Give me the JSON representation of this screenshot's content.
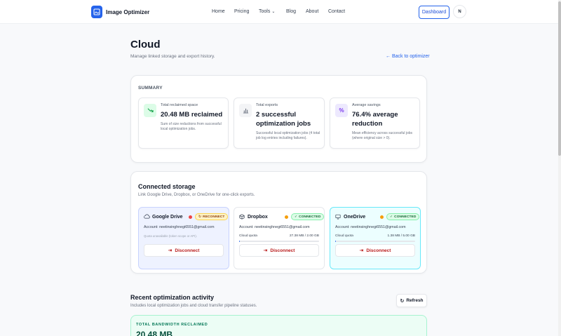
{
  "brand": {
    "name": "Image Optimizer",
    "accent": "#2563eb"
  },
  "nav": {
    "items": [
      "Home",
      "Pricing",
      "Tools",
      "Blog",
      "About",
      "Contact"
    ],
    "dashboard_label": "Dashboard",
    "avatar_initial": "N"
  },
  "page": {
    "title": "Cloud",
    "subtitle": "Manage linked storage and export history.",
    "back_link": "← Back to optimizer"
  },
  "summary": {
    "label": "SUMMARY",
    "stats": [
      {
        "label": "Total reclaimed space",
        "value": "20.48 MB reclaimed",
        "desc": "Sum of size reductions from successful local optimization jobs.",
        "icon": "trend-down-icon",
        "color": "#16a34a"
      },
      {
        "label": "Total exports",
        "value": "2 successful optimization jobs",
        "desc": "Successful local optimization jobs (4 total job log entries including failures).",
        "icon": "bar-chart-icon",
        "color": "#6b7280"
      },
      {
        "label": "Average savings",
        "value": "76.4% average reduction",
        "desc": "Mean efficiency across successful jobs (where original size > 0).",
        "icon": "percent-icon",
        "color": "#7c3aed"
      }
    ]
  },
  "storage": {
    "title": "Connected storage",
    "subtitle": "Link Google Drive, Dropbox, or OneDrive for one-click exports.",
    "providers": [
      {
        "name": "Google Drive",
        "icon": "cloud-icon",
        "dot_color": "#ef4444",
        "badge": "RECONNECT",
        "badge_icon": "↻",
        "account": "Account: neetinsinghnegi6551@gmail.com",
        "note": "Quota unavailable (token scope or API).",
        "disconnect": "Disconnect"
      },
      {
        "name": "Dropbox",
        "icon": "box-icon",
        "dot_color": "#f59e0b",
        "badge": "CONNECTED",
        "badge_icon": "✓",
        "account": "Account: neetinsinghnegi6551@gmail.com",
        "quota_label": "Cloud quota",
        "quota_value": "27.38 MB / 2.00 GB",
        "quota_fraction": 0.013,
        "disconnect": "Disconnect"
      },
      {
        "name": "OneDrive",
        "icon": "monitor-icon",
        "dot_color": "#f59e0b",
        "badge": "CONNECTED",
        "badge_icon": "✓",
        "account": "Account: neetinsinghnegi6551@gmail.com",
        "quota_label": "Cloud quota",
        "quota_value": "1.38 MB / 5.00 GB",
        "quota_fraction": 0.0003,
        "disconnect": "Disconnect"
      }
    ]
  },
  "activity": {
    "title": "Recent optimization activity",
    "subtitle": "Includes local optimization jobs and cloud transfer pipeline statuses.",
    "refresh_label": "Refresh",
    "bandwidth_label": "TOTAL BANDWIDTH RECLAIMED",
    "bandwidth_value": "20.48 MB"
  }
}
